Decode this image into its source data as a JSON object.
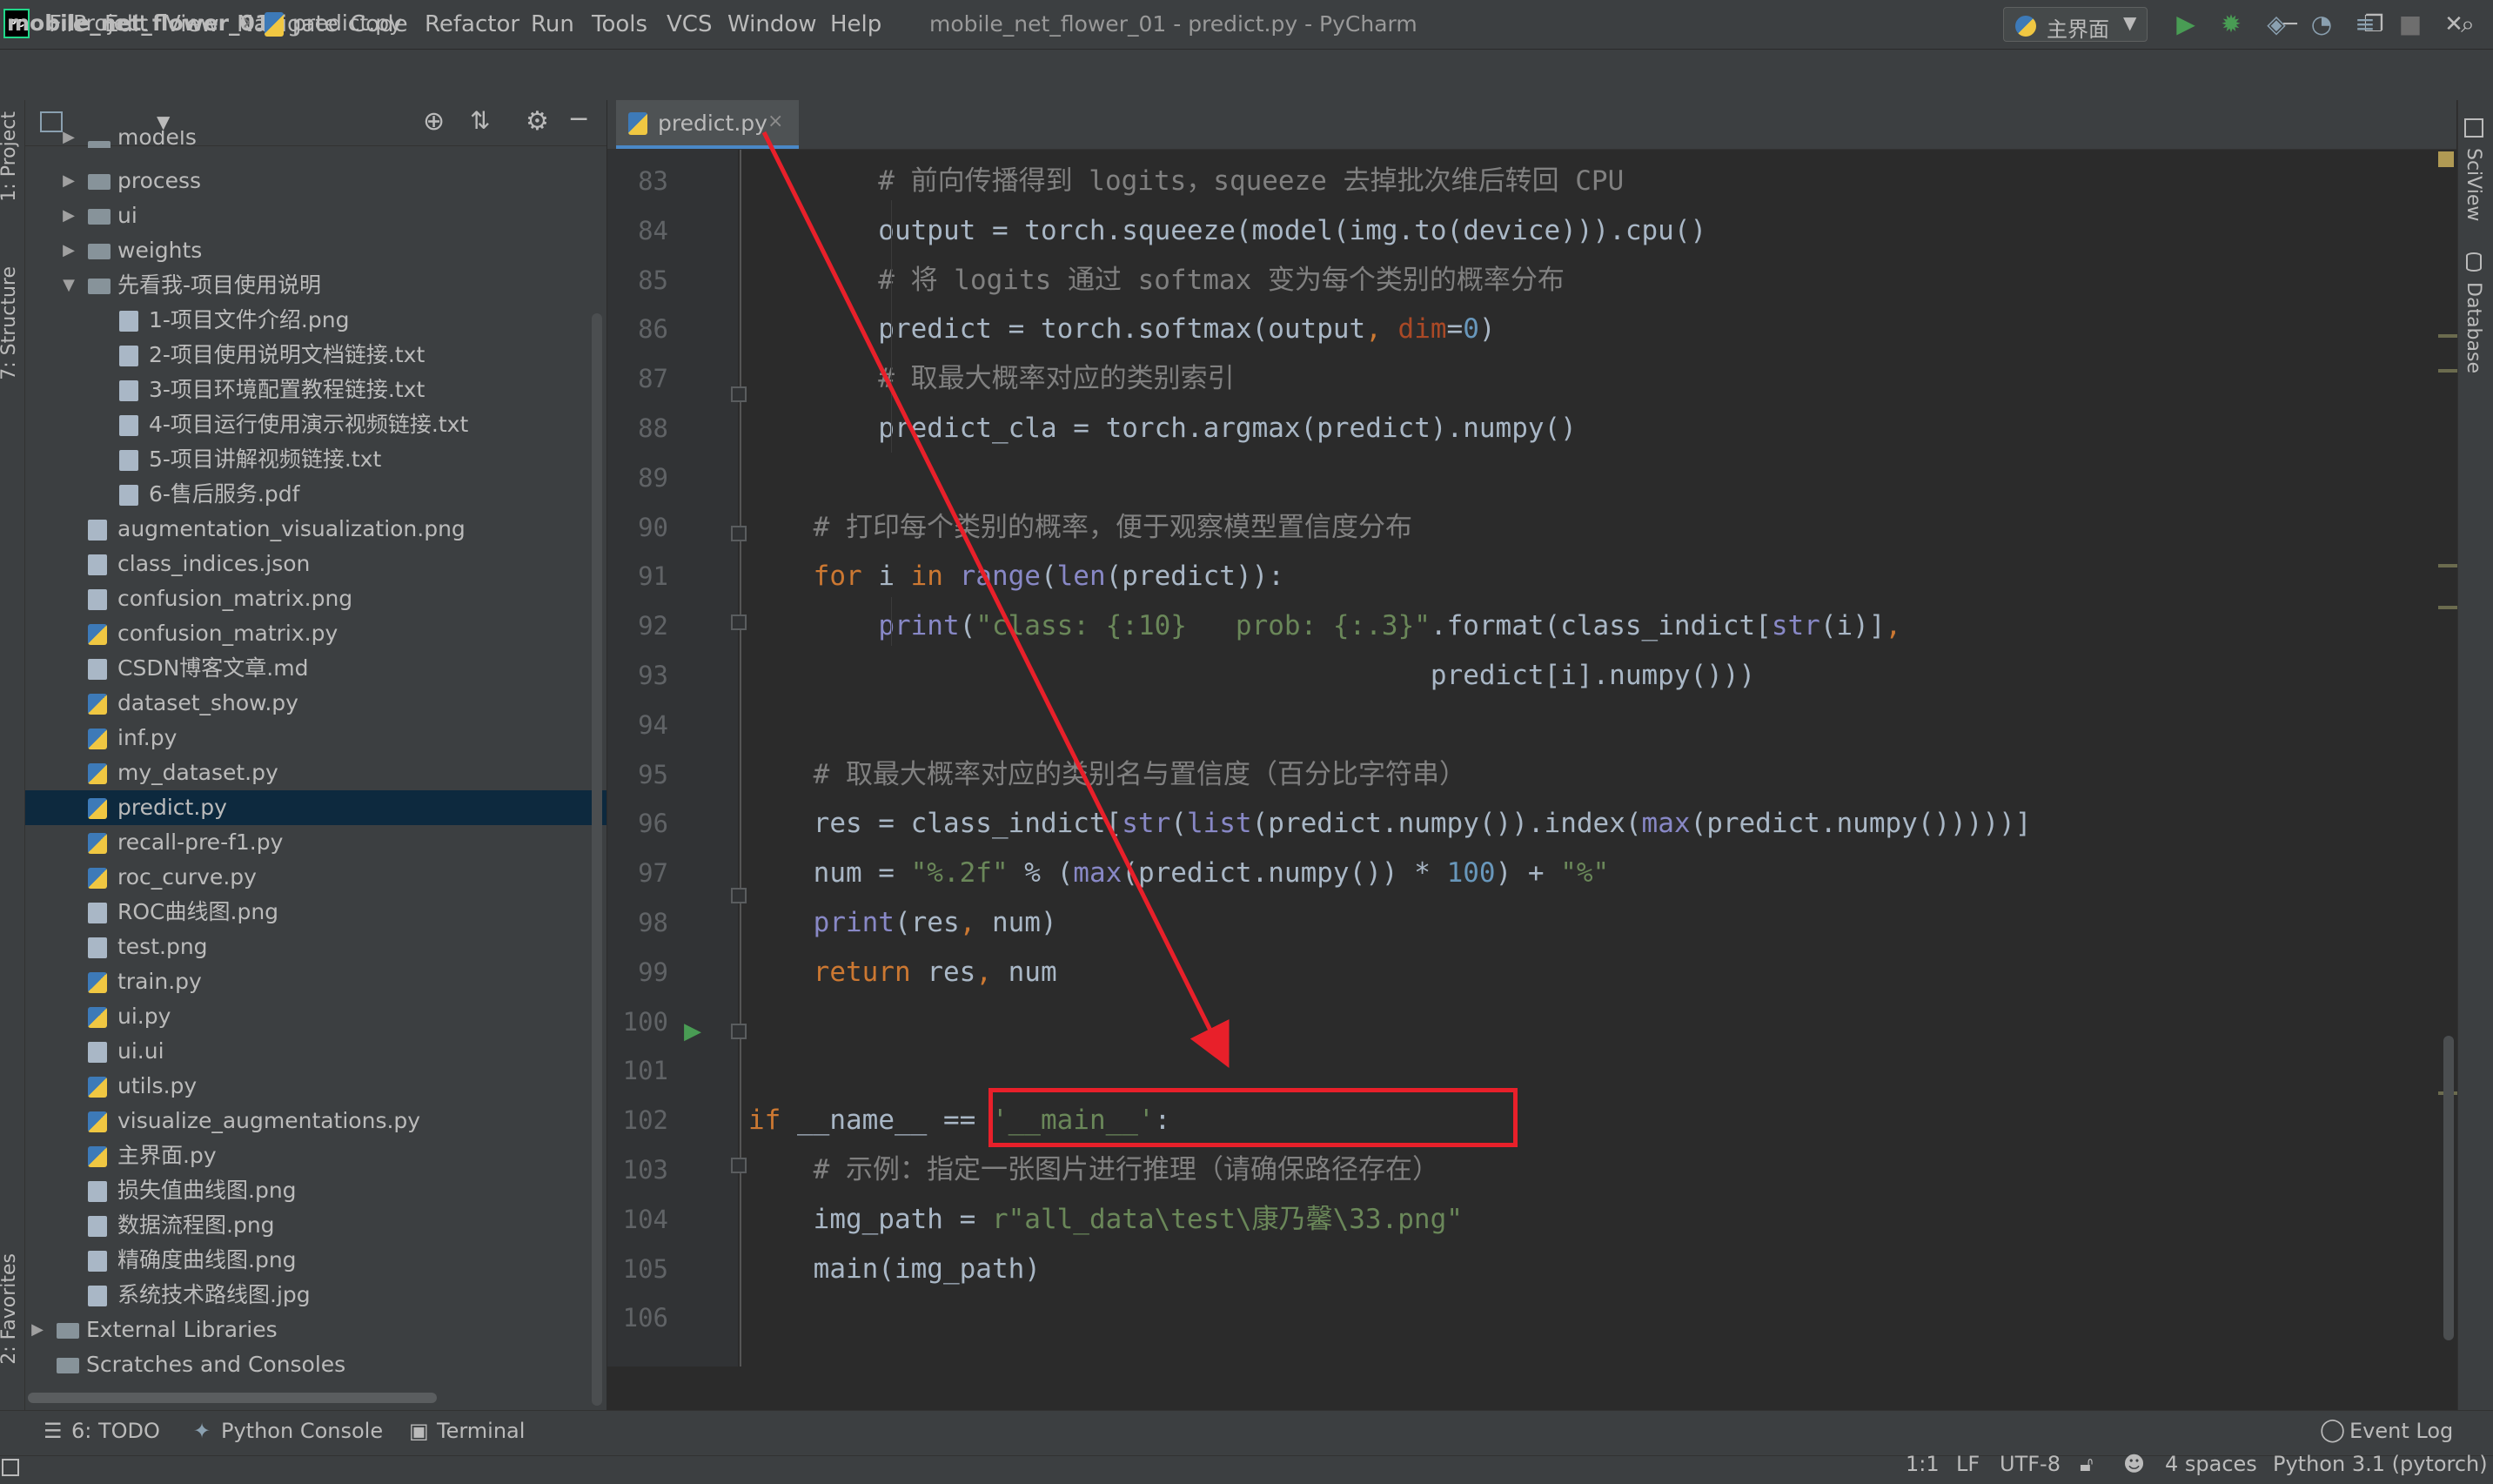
{
  "window": {
    "app_logo": "PC",
    "title": "mobile_net_flower_01 - predict.py - PyCharm",
    "menu": [
      "File",
      "Edit",
      "View",
      "Navigate",
      "Code",
      "Refactor",
      "Run",
      "Tools",
      "VCS",
      "Window",
      "Help"
    ],
    "controls": {
      "minimize": "─",
      "restore": "❐",
      "close": "✕"
    }
  },
  "navbar": {
    "project": "mobile_net_flower_01",
    "separator": "›",
    "file": "predict.py",
    "run_config": "主界面",
    "icons": [
      "run-icon",
      "debug-icon",
      "coverage-icon",
      "profile-icon",
      "concurrency-icon",
      "stop-icon",
      "search-icon"
    ]
  },
  "left_strip": {
    "project_tab": "1: Project",
    "structure_tab": "7: Structure",
    "favorites_tab": "2: Favorites"
  },
  "project": {
    "header": "Project",
    "tree": [
      {
        "label": "models",
        "type": "folder",
        "indent": 1,
        "arrow": "▶"
      },
      {
        "label": "process",
        "type": "folder",
        "indent": 1,
        "arrow": "▶"
      },
      {
        "label": "ui",
        "type": "folder",
        "indent": 1,
        "arrow": "▶"
      },
      {
        "label": "weights",
        "type": "folder",
        "indent": 1,
        "arrow": "▶"
      },
      {
        "label": "先看我-项目使用说明",
        "type": "folder",
        "indent": 1,
        "arrow": "▼"
      },
      {
        "label": "1-项目文件介绍.png",
        "type": "file",
        "indent": 2
      },
      {
        "label": "2-项目使用说明文档链接.txt",
        "type": "file",
        "indent": 2
      },
      {
        "label": "3-项目环境配置教程链接.txt",
        "type": "file",
        "indent": 2
      },
      {
        "label": "4-项目运行使用演示视频链接.txt",
        "type": "file",
        "indent": 2
      },
      {
        "label": "5-项目讲解视频链接.txt",
        "type": "file",
        "indent": 2
      },
      {
        "label": "6-售后服务.pdf",
        "type": "file",
        "indent": 2
      },
      {
        "label": "augmentation_visualization.png",
        "type": "file",
        "indent": 1
      },
      {
        "label": "class_indices.json",
        "type": "file",
        "indent": 1
      },
      {
        "label": "confusion_matrix.png",
        "type": "file",
        "indent": 1
      },
      {
        "label": "confusion_matrix.py",
        "type": "py",
        "indent": 1
      },
      {
        "label": "CSDN博客文章.md",
        "type": "file",
        "indent": 1
      },
      {
        "label": "dataset_show.py",
        "type": "py",
        "indent": 1
      },
      {
        "label": "inf.py",
        "type": "py",
        "indent": 1
      },
      {
        "label": "my_dataset.py",
        "type": "py",
        "indent": 1
      },
      {
        "label": "predict.py",
        "type": "py",
        "indent": 1,
        "selected": true
      },
      {
        "label": "recall-pre-f1.py",
        "type": "py",
        "indent": 1
      },
      {
        "label": "roc_curve.py",
        "type": "py",
        "indent": 1
      },
      {
        "label": "ROC曲线图.png",
        "type": "file",
        "indent": 1
      },
      {
        "label": "test.png",
        "type": "file",
        "indent": 1
      },
      {
        "label": "train.py",
        "type": "py",
        "indent": 1
      },
      {
        "label": "ui.py",
        "type": "py",
        "indent": 1
      },
      {
        "label": "ui.ui",
        "type": "file",
        "indent": 1
      },
      {
        "label": "utils.py",
        "type": "py",
        "indent": 1
      },
      {
        "label": "visualize_augmentations.py",
        "type": "py",
        "indent": 1
      },
      {
        "label": "主界面.py",
        "type": "py",
        "indent": 1
      },
      {
        "label": "损失值曲线图.png",
        "type": "file",
        "indent": 1
      },
      {
        "label": "数据流程图.png",
        "type": "file",
        "indent": 1
      },
      {
        "label": "精确度曲线图.png",
        "type": "file",
        "indent": 1
      },
      {
        "label": "系统技术路线图.jpg",
        "type": "file",
        "indent": 1
      },
      {
        "label": "External Libraries",
        "type": "lib",
        "indent": 0,
        "arrow": "▶"
      },
      {
        "label": "Scratches and Consoles",
        "type": "lib",
        "indent": 0
      }
    ]
  },
  "editor": {
    "tab_label": "predict.py",
    "tab_close": "×",
    "line_numbers": [
      "83",
      "84",
      "85",
      "86",
      "87",
      "88",
      "89",
      "90",
      "91",
      "92",
      "93",
      "94",
      "95",
      "96",
      "97",
      "98",
      "99",
      "100",
      "101",
      "102",
      "103",
      "104",
      "105",
      "106"
    ],
    "code_lines": [
      [
        [
          "cm",
          "        # 前向传播得到 logits，squeeze 去掉批次维后转回 CPU"
        ]
      ],
      [
        [
          "tx",
          "        output = torch.squeeze(model(img.to(device))).cpu()"
        ]
      ],
      [
        [
          "cm",
          "        # 将 logits 通过 softmax 变为每个类别的概率分布"
        ]
      ],
      [
        [
          "tx",
          "        predict = torch.softmax(output"
        ],
        [
          "kw",
          ", "
        ],
        [
          "kwarg",
          "dim"
        ],
        [
          "tx",
          "="
        ],
        [
          "nu",
          "0"
        ],
        [
          "tx",
          ")"
        ]
      ],
      [
        [
          "cm",
          "        # 取最大概率对应的类别索引"
        ]
      ],
      [
        [
          "tx",
          "        predict_cla = torch.argmax(predict).numpy()"
        ]
      ],
      [
        [
          "tx",
          ""
        ]
      ],
      [
        [
          "cm",
          "    # 打印每个类别的概率，便于观察模型置信度分布"
        ]
      ],
      [
        [
          "kw",
          "    for "
        ],
        [
          "tx",
          "i "
        ],
        [
          "kw",
          "in "
        ],
        [
          "bi",
          "range"
        ],
        [
          "tx",
          "("
        ],
        [
          "bi",
          "len"
        ],
        [
          "tx",
          "(predict)):"
        ]
      ],
      [
        [
          "tx",
          "        "
        ],
        [
          "bi",
          "print"
        ],
        [
          "tx",
          "("
        ],
        [
          "st",
          "\"class: {:10}   prob: {:.3}\""
        ],
        [
          "tx",
          ".format(class_indict["
        ],
        [
          "bi",
          "str"
        ],
        [
          "tx",
          "(i)]"
        ],
        [
          "kw",
          ","
        ]
      ],
      [
        [
          "tx",
          "                                          predict[i].numpy()))"
        ]
      ],
      [
        [
          "tx",
          ""
        ]
      ],
      [
        [
          "cm",
          "    # 取最大概率对应的类别名与置信度（百分比字符串）"
        ]
      ],
      [
        [
          "tx",
          "    res = class_indict["
        ],
        [
          "bi",
          "str"
        ],
        [
          "tx",
          "("
        ],
        [
          "bi",
          "list"
        ],
        [
          "tx",
          "(predict.numpy()).index("
        ],
        [
          "bi",
          "max"
        ],
        [
          "tx",
          "(predict.numpy()))))]"
        ]
      ],
      [
        [
          "tx",
          "    num = "
        ],
        [
          "st",
          "\"%.2f\""
        ],
        [
          "tx",
          " % ("
        ],
        [
          "bi",
          "max"
        ],
        [
          "tx",
          "(predict.numpy()) * "
        ],
        [
          "nu",
          "100"
        ],
        [
          "tx",
          ") + "
        ],
        [
          "st",
          "\"%\""
        ]
      ],
      [
        [
          "tx",
          "    "
        ],
        [
          "bi",
          "print"
        ],
        [
          "tx",
          "(res"
        ],
        [
          "kw",
          ", "
        ],
        [
          "tx",
          "num)"
        ]
      ],
      [
        [
          "kw",
          "    return "
        ],
        [
          "tx",
          "res"
        ],
        [
          "kw",
          ", "
        ],
        [
          "tx",
          "num"
        ]
      ],
      [
        [
          "tx",
          ""
        ]
      ],
      [
        [
          "tx",
          ""
        ]
      ],
      [
        [
          "kw",
          "if "
        ],
        [
          "tx",
          "__name__ == "
        ],
        [
          "st",
          "'__main__'"
        ],
        [
          "tx",
          ":"
        ]
      ],
      [
        [
          "cm",
          "    # 示例：指定一张图片进行推理（请确保路径存在）"
        ]
      ],
      [
        [
          "tx",
          "    img_path = "
        ],
        [
          "st",
          "r\"all_data\\test\\康乃馨\\33.png\""
        ]
      ],
      [
        [
          "tx",
          "    main(img_path)"
        ]
      ],
      [
        [
          "tx",
          ""
        ]
      ]
    ]
  },
  "right_strip": {
    "sciview": "SciView",
    "database": "Database"
  },
  "bottom_tools": {
    "todo": "6: TODO",
    "python_console": "Python Console",
    "terminal": "Terminal",
    "event_log": "Event Log"
  },
  "status": {
    "position": "1:1",
    "line_sep": "LF",
    "encoding": "UTF-8",
    "indent": "4 spaces",
    "interpreter": "Python 3.1 (pytorch)"
  },
  "colors": {
    "highlight": "#e8202a",
    "arrow": "#e8202a",
    "selection": "#0d293e",
    "accent": "#4a88c7"
  }
}
